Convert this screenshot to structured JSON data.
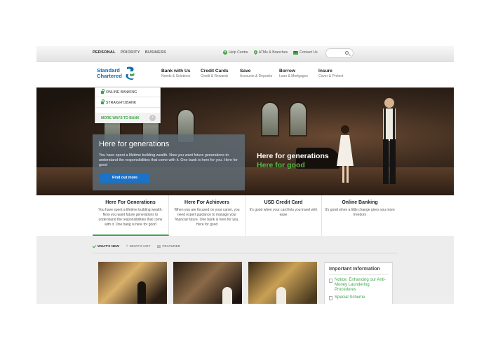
{
  "utility": {
    "segments": [
      "PERSONAL",
      "PRIORITY",
      "BUSINESS"
    ],
    "links": [
      {
        "icon": "help-icon",
        "label": "Help Centre"
      },
      {
        "icon": "location-pin-icon",
        "label": "ATMs & Branches"
      },
      {
        "icon": "mail-icon",
        "label": "Contact Us"
      }
    ]
  },
  "header": {
    "logo_line1": "Standard",
    "logo_line2": "Chartered",
    "nav": [
      {
        "title": "Bank with Us",
        "sub": "Needs & Solutions"
      },
      {
        "title": "Credit Cards",
        "sub": "Credit & Rewards"
      },
      {
        "title": "Save",
        "sub": "Accounts & Deposits"
      },
      {
        "title": "Borrow",
        "sub": "Loan & Mortgages"
      },
      {
        "title": "Insure",
        "sub": "Cover & Protect"
      }
    ]
  },
  "dropdown": {
    "items": [
      "ONLINE BANKING",
      "STRAIGHT2BANK"
    ],
    "more": "MORE WAYS TO BANK"
  },
  "hero": {
    "title_line1": "Here for generations",
    "title_line2": "Here for good",
    "box_title": "Here for generations",
    "box_text": "You have spent a lifetime building wealth. Now you want future generations to understand the responsibilities that come with it. One bank is here for you. Here for good",
    "cta": "Find out more"
  },
  "features": [
    {
      "title": "Here For Generations",
      "text": "You have spent a lifetime building wealth. Now you want future generations to understand the responsibilities that come with it. One bang is here for good"
    },
    {
      "title": "Here For Achievers",
      "text": "When you are focused on your carrer, you need expert guidance to manage your financial future. One bank is here for you. Here for good"
    },
    {
      "title": "USD Credit Card",
      "text": "It's good when your card lets you travel with ease"
    },
    {
      "title": "Online Banking",
      "text": "It's good when a little change gives you more freedom"
    }
  ],
  "tabs": [
    "WHAT'S NEW",
    "WHAT'S HOT",
    "FEATURED"
  ],
  "info": {
    "title": "Important Information",
    "links": [
      "Notice: Enhancing our Anti-Money Laundering Procedures",
      "Special Scheme"
    ]
  },
  "colors": {
    "brand_blue": "#1069b0",
    "brand_green": "#3fa44a",
    "cta_blue": "#1a73c8"
  }
}
